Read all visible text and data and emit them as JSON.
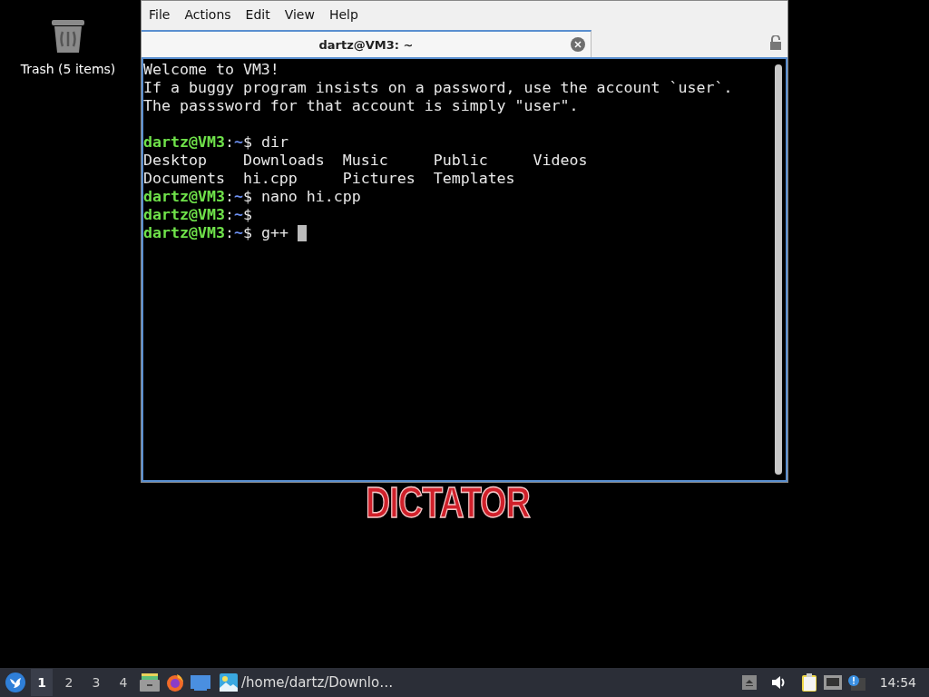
{
  "desktop": {
    "icons": [
      {
        "label": "Trash (5 items)"
      }
    ],
    "wallpaper": {
      "text": "DICTATOR"
    }
  },
  "terminal": {
    "menu": [
      "File",
      "Actions",
      "Edit",
      "View",
      "Help"
    ],
    "tabs": [
      {
        "title": "dartz@VM3: ~",
        "selected": true
      }
    ],
    "lines": [
      {
        "kind": "output",
        "text": "Welcome to VM3!"
      },
      {
        "kind": "output",
        "text": "If a buggy program insists on a password, use the account `user`."
      },
      {
        "kind": "output",
        "text": "The passsword for that account is simply \"user\"."
      },
      {
        "kind": "blank"
      },
      {
        "kind": "prompt",
        "user": "dartz@VM3",
        "sep": ":",
        "path": "~",
        "command": "$ dir"
      },
      {
        "kind": "output",
        "text": "Desktop    Downloads  Music     Public     Videos"
      },
      {
        "kind": "output",
        "text": "Documents  hi.cpp     Pictures  Templates"
      },
      {
        "kind": "prompt",
        "user": "dartz@VM3",
        "sep": ":",
        "path": "~",
        "command": "$ nano hi.cpp"
      },
      {
        "kind": "prompt",
        "user": "dartz@VM3",
        "sep": ":",
        "path": "~",
        "command": "$"
      },
      {
        "kind": "prompt",
        "user": "dartz@VM3",
        "sep": ":",
        "path": "~",
        "command": "$ g++",
        "cursor": true
      }
    ]
  },
  "taskbar": {
    "workspaces": [
      {
        "label": "1",
        "selected": true
      },
      {
        "label": "2",
        "selected": false
      },
      {
        "label": "3",
        "selected": false
      },
      {
        "label": "4",
        "selected": false
      }
    ],
    "tasks": [
      {
        "title": "/home/dartz/Downlo…"
      }
    ],
    "clock": "14:54"
  }
}
